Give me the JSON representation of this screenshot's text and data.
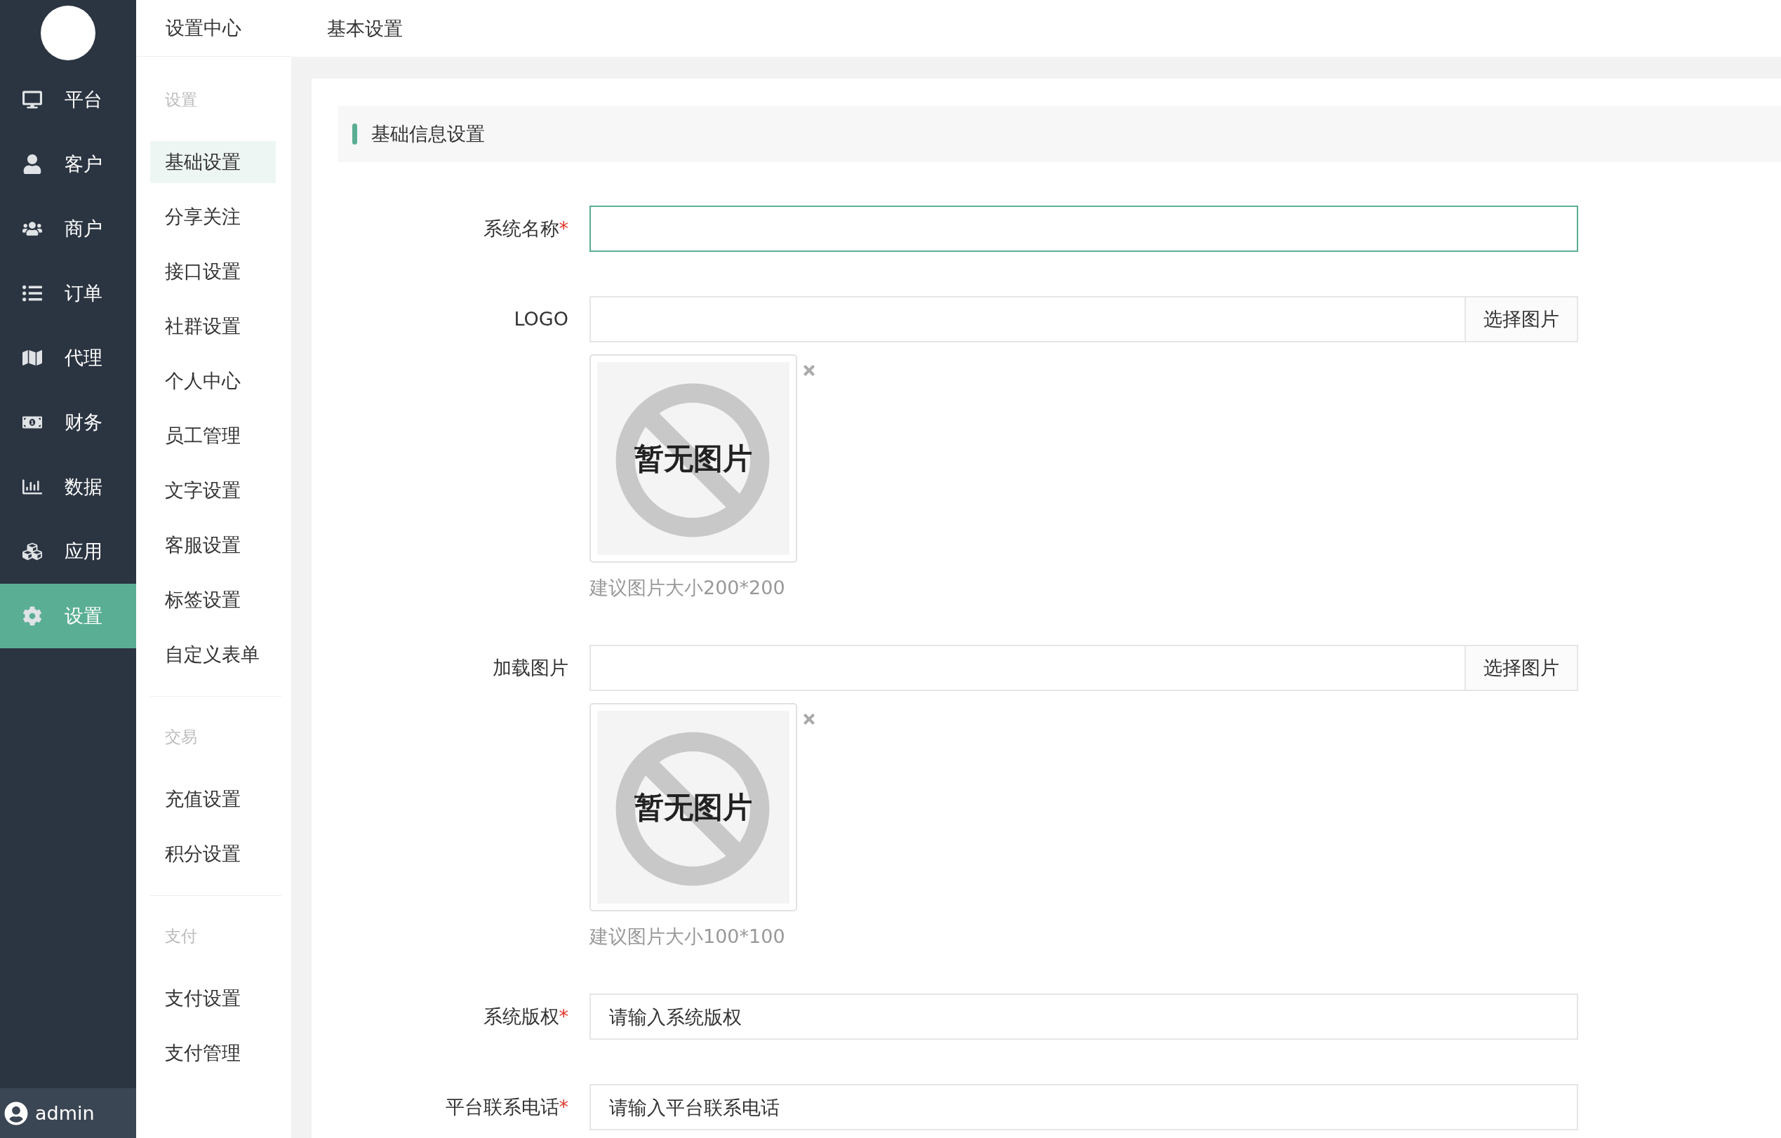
{
  "nav": {
    "user": "admin",
    "items": [
      {
        "label": "平台",
        "selected": false
      },
      {
        "label": "客户",
        "selected": false
      },
      {
        "label": "商户",
        "selected": false
      },
      {
        "label": "订单",
        "selected": false
      },
      {
        "label": "代理",
        "selected": false
      },
      {
        "label": "财务",
        "selected": false
      },
      {
        "label": "数据",
        "selected": false
      },
      {
        "label": "应用",
        "selected": false
      },
      {
        "label": "设置",
        "selected": true
      }
    ]
  },
  "subnav": {
    "title": "设置中心",
    "groups": [
      {
        "title": "设置",
        "items": [
          {
            "label": "基础设置",
            "selected": true
          },
          {
            "label": "分享关注",
            "selected": false
          },
          {
            "label": "接口设置",
            "selected": false
          },
          {
            "label": "社群设置",
            "selected": false
          },
          {
            "label": "个人中心",
            "selected": false
          },
          {
            "label": "员工管理",
            "selected": false
          },
          {
            "label": "文字设置",
            "selected": false
          },
          {
            "label": "客服设置",
            "selected": false
          },
          {
            "label": "标签设置",
            "selected": false
          },
          {
            "label": "自定义表单",
            "selected": false
          }
        ]
      },
      {
        "title": "交易",
        "items": [
          {
            "label": "充值设置",
            "selected": false
          },
          {
            "label": "积分设置",
            "selected": false
          }
        ]
      },
      {
        "title": "支付",
        "items": [
          {
            "label": "支付设置",
            "selected": false
          },
          {
            "label": "支付管理",
            "selected": false
          }
        ]
      }
    ]
  },
  "header": {
    "breadcrumb": "基本设置"
  },
  "section": {
    "title": "基础信息设置"
  },
  "fields": [
    {
      "kind": "text",
      "label": "系统名称",
      "mark": "*",
      "focused": true
    },
    {
      "kind": "image",
      "label": "LOGO",
      "button": "选择图片",
      "image_text": "暂无图片",
      "hint": "建议图片大小200*200"
    },
    {
      "kind": "image",
      "label": "加载图片",
      "button": "选择图片",
      "image_text": "暂无图片",
      "hint": "建议图片大小100*100"
    },
    {
      "kind": "text",
      "label": "系统版权",
      "mark": "*",
      "focused": false,
      "placeholder": "请输入系统版权"
    },
    {
      "kind": "text",
      "label": "平台联系电话",
      "mark": "*",
      "focused": false,
      "placeholder": "请输入平台联系电话"
    }
  ]
}
